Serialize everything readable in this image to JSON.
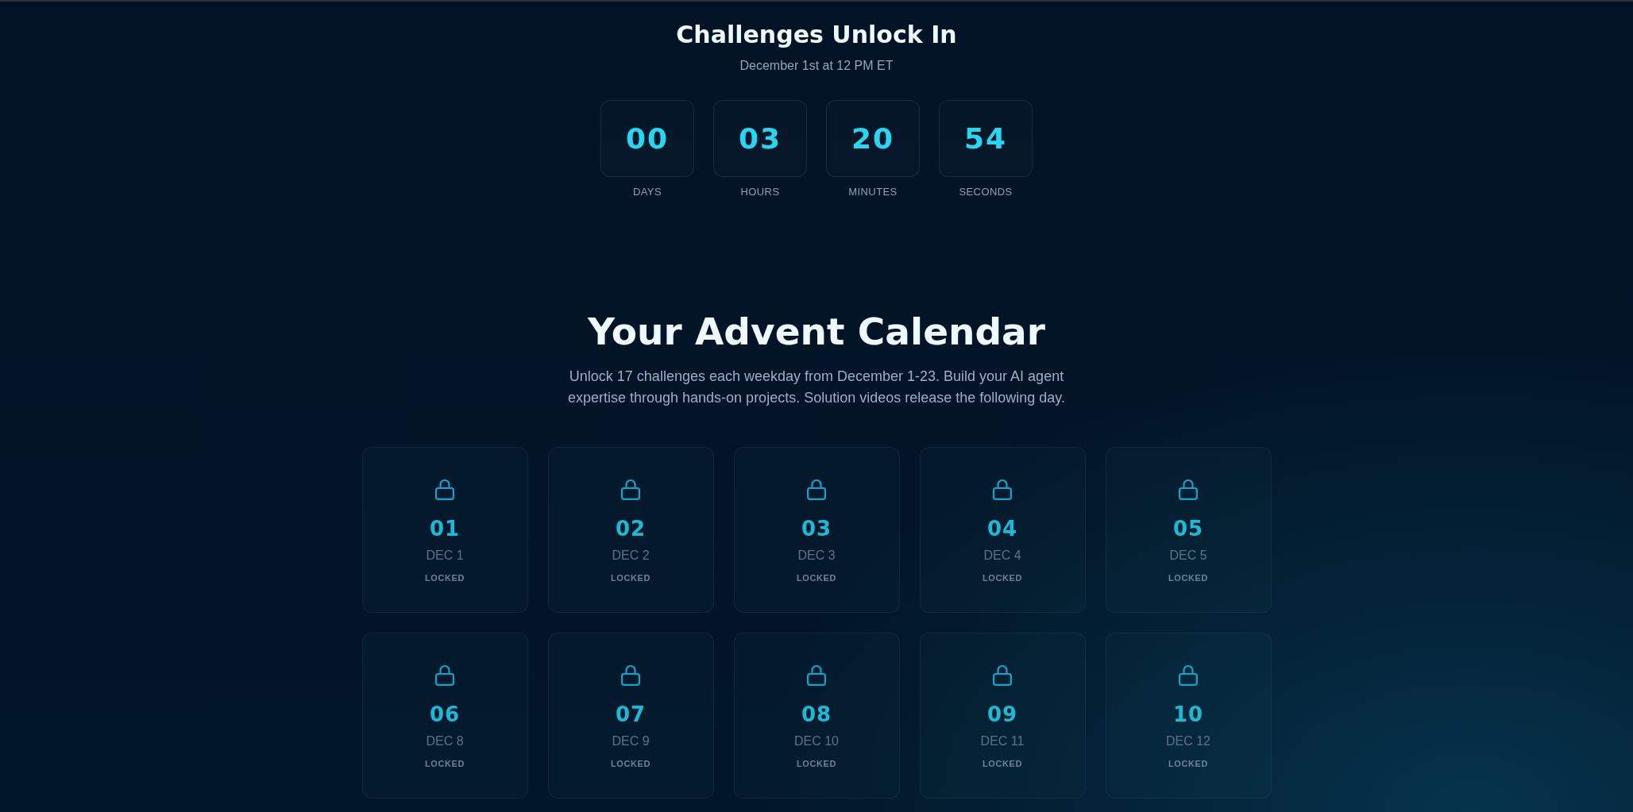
{
  "countdown": {
    "title": "Challenges Unlock In",
    "subtitle": "December 1st at 12 PM ET",
    "units": [
      {
        "value": "00",
        "label": "DAYS"
      },
      {
        "value": "03",
        "label": "HOURS"
      },
      {
        "value": "20",
        "label": "MINUTES"
      },
      {
        "value": "54",
        "label": "SECONDS"
      }
    ]
  },
  "calendar": {
    "title": "Your Advent Calendar",
    "description": "Unlock 17 challenges each weekday from December 1-23. Build your AI agent expertise through hands-on projects. Solution videos release the following day.",
    "days": [
      {
        "number": "01",
        "date": "DEC 1",
        "status": "LOCKED",
        "locked": true
      },
      {
        "number": "02",
        "date": "DEC 2",
        "status": "LOCKED",
        "locked": true
      },
      {
        "number": "03",
        "date": "DEC 3",
        "status": "LOCKED",
        "locked": true
      },
      {
        "number": "04",
        "date": "DEC 4",
        "status": "LOCKED",
        "locked": true
      },
      {
        "number": "05",
        "date": "DEC 5",
        "status": "LOCKED",
        "locked": true
      },
      {
        "number": "06",
        "date": "DEC 8",
        "status": "LOCKED",
        "locked": true
      },
      {
        "number": "07",
        "date": "DEC 9",
        "status": "LOCKED",
        "locked": true
      },
      {
        "number": "08",
        "date": "DEC 10",
        "status": "LOCKED",
        "locked": true
      },
      {
        "number": "09",
        "date": "DEC 11",
        "status": "LOCKED",
        "locked": true
      },
      {
        "number": "10",
        "date": "DEC 12",
        "status": "LOCKED",
        "locked": true
      }
    ]
  }
}
